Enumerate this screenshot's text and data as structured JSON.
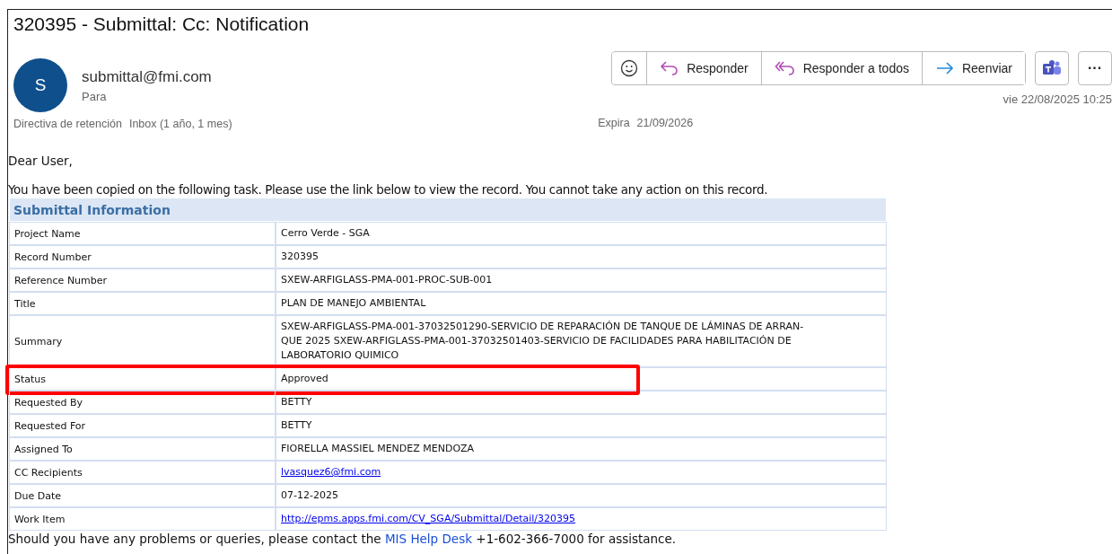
{
  "message": {
    "subject": "320395 - Submittal: Cc: Notification",
    "avatar_letter": "S",
    "sender": "submittal@fmi.com",
    "to_label": "Para",
    "retention_label": "Directiva de retención",
    "retention_value": "Inbox (1 año, 1 mes)",
    "expires_label": "Expira",
    "expires_value": "21/09/2026",
    "date": "vie 22/08/2025 10:25"
  },
  "actions": [
    {
      "kind": "emoji"
    },
    {
      "kind": "reply",
      "label": "Responder"
    },
    {
      "kind": "reply_all",
      "label": "Responder a todos"
    },
    {
      "kind": "forward",
      "label": "Reenviar"
    }
  ],
  "extra_buttons": [
    {
      "kind": "teams"
    },
    {
      "kind": "more",
      "label": "···"
    }
  ],
  "body": {
    "greeting": "Dear User,",
    "intro": "You have been copied on the following task. Please use the link below to view the record. You cannot take any action on this record.",
    "table": {
      "title": "Submittal Information",
      "rows": [
        {
          "label": "Project Name",
          "lines": [
            "Cerro Verde - SGA"
          ],
          "link": false,
          "highlighted": false
        },
        {
          "label": "Record Number",
          "lines": [
            "320395"
          ],
          "link": false,
          "highlighted": false
        },
        {
          "label": "Reference Number",
          "lines": [
            "SXEW-ARFIGLASS-PMA-001-PROC-SUB-001"
          ],
          "link": false,
          "highlighted": false
        },
        {
          "label": "Title",
          "lines": [
            "PLAN DE MANEJO AMBIENTAL"
          ],
          "link": false,
          "highlighted": false
        },
        {
          "label": "Summary",
          "lines": [
            "SXEW-ARFIGLASS-PMA-001-37032501290-SERVICIO DE REPARACIÓN DE TANQUE DE LÁMINAS DE ARRAN-",
            "QUE 2025 SXEW-ARFIGLASS-PMA-001-37032501403-SERVICIO DE FACILIDADES PARA HABILITACIÓN DE",
            "LABORATORIO QUIMICO"
          ],
          "link": false,
          "highlighted": false
        },
        {
          "label": "Status",
          "lines": [
            "Approved"
          ],
          "link": false,
          "highlighted": true
        },
        {
          "label": "Requested By",
          "lines": [
            "BETTY"
          ],
          "link": false,
          "highlighted": false
        },
        {
          "label": "Requested For",
          "lines": [
            "BETTY"
          ],
          "link": false,
          "highlighted": false
        },
        {
          "label": "Assigned To",
          "lines": [
            "FIORELLA MASSIEL MENDEZ MENDOZA"
          ],
          "link": false,
          "highlighted": false
        },
        {
          "label": "CC Recipients",
          "lines": [
            "lvasquez6@fmi.com"
          ],
          "link": true,
          "highlighted": false
        },
        {
          "label": "Due Date",
          "lines": [
            "07-12-2025"
          ],
          "link": false,
          "highlighted": false
        },
        {
          "label": "Work Item",
          "lines": [
            "http://epms.apps.fmi.com/CV_SGA/Submittal/Detail/320395"
          ],
          "link": true,
          "highlighted": false
        }
      ]
    },
    "footer_before": "Should you have any problems or queries, please contact the",
    "footer_link": "MIS Help Desk",
    "footer_after": "+1-602-366-7000 for assistance."
  }
}
